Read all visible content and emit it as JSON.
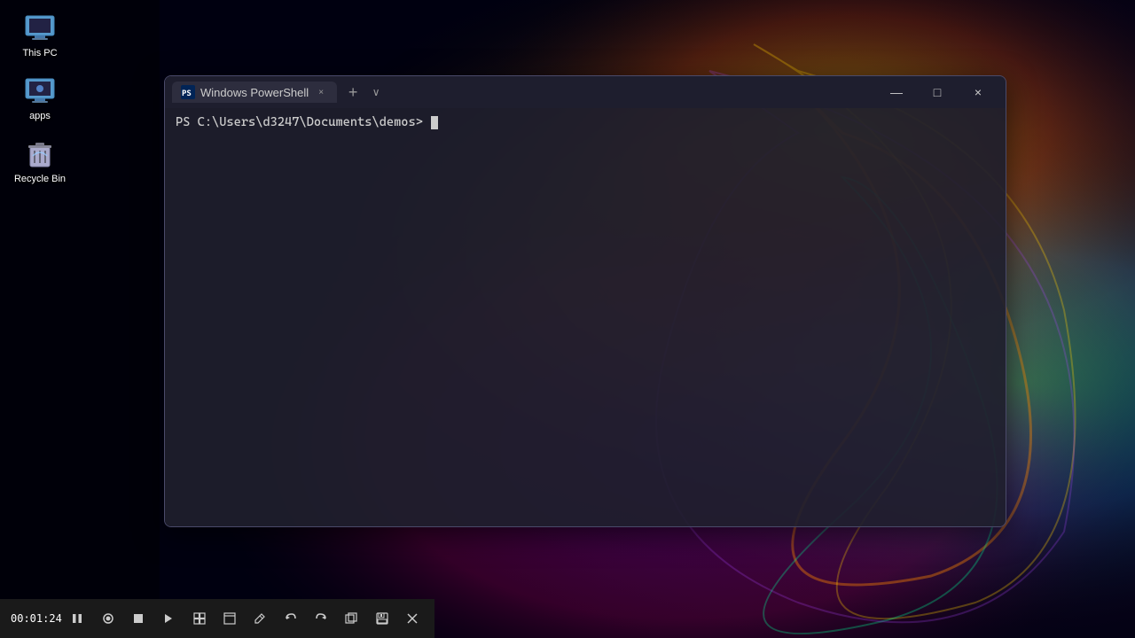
{
  "desktop": {
    "icons": [
      {
        "id": "this-pc",
        "label": "This PC",
        "color": "#4a9eff"
      },
      {
        "id": "apps",
        "label": "apps",
        "color": "#4a9eff"
      },
      {
        "id": "recycle-bin",
        "label": "Recycle Bin",
        "color": "#aaa"
      }
    ]
  },
  "powershell": {
    "title": "Windows PowerShell",
    "tab_label": "Windows PowerShell",
    "prompt": "PS C:\\Users\\d3247\\Documents\\demos> ",
    "close_label": "×",
    "minimize_label": "—",
    "maximize_label": "□",
    "new_tab_label": "+",
    "dropdown_label": "∨"
  },
  "toolbar": {
    "time": "00:01:24",
    "buttons": [
      {
        "id": "pause",
        "icon": "⏸"
      },
      {
        "id": "record-circle",
        "icon": "⏺"
      },
      {
        "id": "stop",
        "icon": "⏹"
      },
      {
        "id": "play",
        "icon": "▶"
      },
      {
        "id": "layout",
        "icon": "▦"
      },
      {
        "id": "window",
        "icon": "□"
      },
      {
        "id": "pen",
        "icon": "✏"
      },
      {
        "id": "undo",
        "icon": "↩"
      },
      {
        "id": "redo",
        "icon": "↪"
      },
      {
        "id": "copy",
        "icon": "⧉"
      },
      {
        "id": "save",
        "icon": "💾"
      },
      {
        "id": "close",
        "icon": "✕"
      }
    ]
  }
}
